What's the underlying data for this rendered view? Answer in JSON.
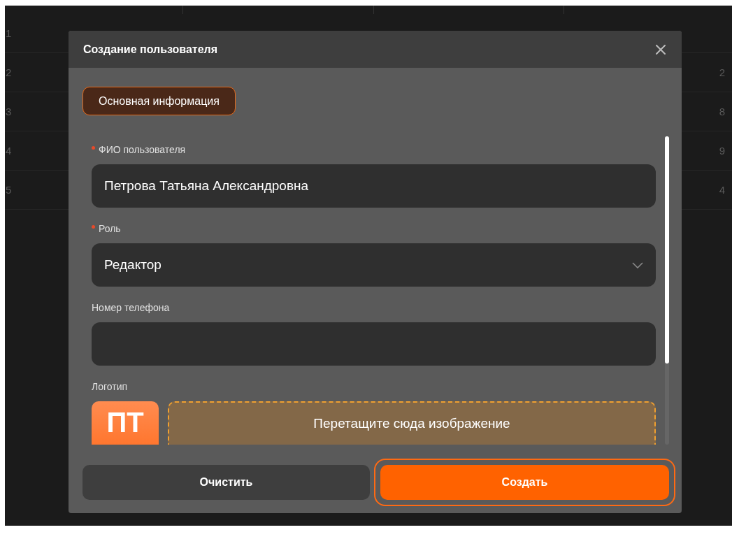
{
  "background_table": {
    "rows": [
      {
        "number": "1"
      },
      {
        "number": "2",
        "edge_text": "2"
      },
      {
        "number": "3",
        "edge_text": "8"
      },
      {
        "number": "4",
        "edge_text": "9"
      },
      {
        "number": "5",
        "edge_text": "4"
      }
    ]
  },
  "dialog": {
    "title": "Создание пользователя",
    "tabs": [
      {
        "label": "Основная информация",
        "selected": true
      }
    ],
    "fields": [
      {
        "kind": "text",
        "label": "ФИО пользователя",
        "required": true,
        "value": "Петрова Татьяна Александровна"
      },
      {
        "kind": "select",
        "label": "Роль",
        "required": true,
        "value": "Редактор"
      },
      {
        "kind": "text",
        "label": "Номер телефона",
        "required": false
      },
      {
        "kind": "upload",
        "label": "Логотип",
        "required": false,
        "initials": "ПТ",
        "dropzone_text": "Перетащите сюда изображение"
      }
    ],
    "buttons": [
      {
        "kind": "secondary",
        "label": "Очистить",
        "focused": false
      },
      {
        "kind": "primary",
        "label": "Создать",
        "focused": true
      }
    ]
  }
}
